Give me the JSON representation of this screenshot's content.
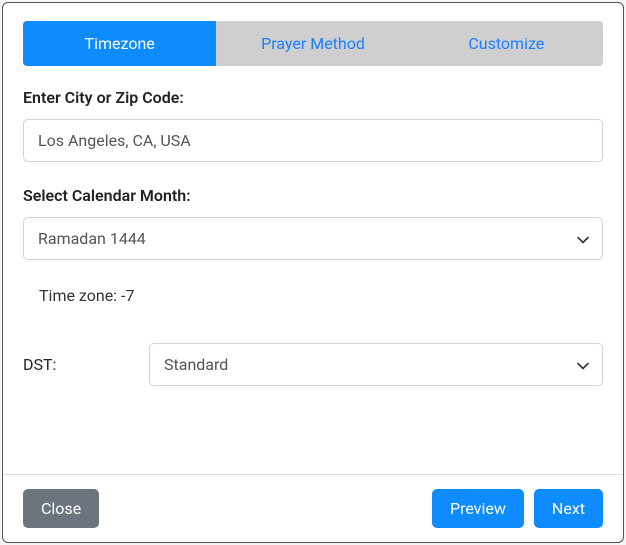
{
  "tabs": {
    "timezone": "Timezone",
    "prayer_method": "Prayer Method",
    "customize": "Customize"
  },
  "form": {
    "city_label": "Enter City or Zip Code:",
    "city_value": "Los Angeles, CA, USA",
    "month_label": "Select Calendar Month:",
    "month_value": "Ramadan 1444",
    "timezone_text": "Time zone: -7",
    "dst_label": "DST:",
    "dst_value": "Standard"
  },
  "footer": {
    "close": "Close",
    "preview": "Preview",
    "next": "Next"
  }
}
